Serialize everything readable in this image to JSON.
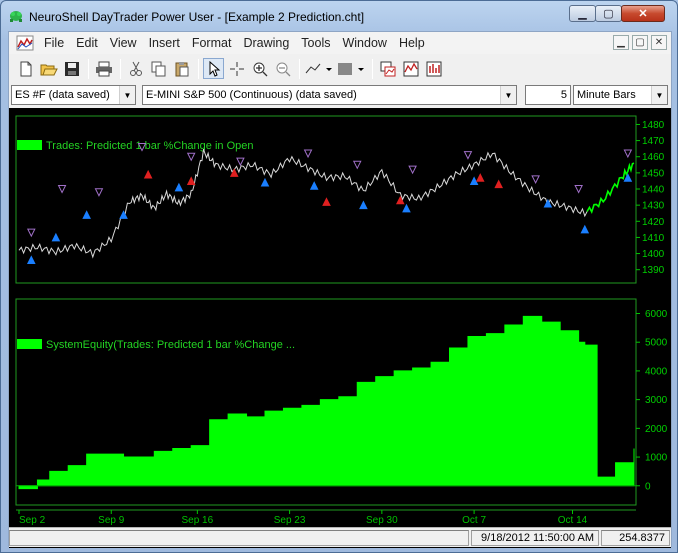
{
  "window": {
    "title": "NeuroShell DayTrader Power User - [Example 2 Prediction.cht]",
    "controls": {
      "minimize": "▁",
      "maximize": "▢",
      "close": "✕"
    }
  },
  "menu": {
    "items": [
      "File",
      "Edit",
      "View",
      "Insert",
      "Format",
      "Drawing",
      "Tools",
      "Window",
      "Help"
    ],
    "mdi": {
      "minimize": "▁",
      "restore": "▢",
      "close": "✕"
    }
  },
  "toolbar": {
    "icons": [
      "new-file-icon",
      "open-folder-icon",
      "save-icon",
      "print-icon",
      "cut-icon",
      "copy-icon",
      "paste-icon",
      "pointer-icon",
      "crosshair-icon",
      "zoom-in-icon",
      "zoom-out-icon",
      "line-draw-icon",
      "fill-pattern-icon",
      "chart-window-icon",
      "chart-style-icon",
      "chart-bars-icon"
    ]
  },
  "selectors": {
    "symbol": "ES #F (data saved)",
    "instrument": "E-MINI S&P 500 (Continuous) (data saved)",
    "bar_count": "5",
    "bar_type": "Minute Bars"
  },
  "status": {
    "datetime": "9/18/2012 11:50:00 AM",
    "value": "254.8377"
  },
  "colors": {
    "price_line": "#d9d9d9",
    "green": "#00ff00",
    "buy_marker": "#1a7fff",
    "sell_marker": "#a070c8",
    "short_marker": "#e02020",
    "axis": "#00c800"
  },
  "chart_data": [
    {
      "type": "line",
      "title": "Trades: Predicted 1 bar %Change in Open",
      "ylim": [
        1383,
        1484
      ],
      "y_ticks": [
        1390,
        1400,
        1410,
        1420,
        1430,
        1440,
        1450,
        1460,
        1470,
        1480
      ],
      "x_ticks": [
        "Sep 2",
        "Sep 9",
        "Sep 16",
        "Sep 23",
        "Sep 30",
        "Oct 7",
        "Oct 14"
      ],
      "x": [
        0,
        3,
        6,
        9,
        12,
        15,
        18,
        20,
        22,
        24,
        26,
        28,
        30,
        32,
        35,
        38,
        41,
        44,
        47,
        50,
        53,
        56,
        59,
        62,
        65,
        68,
        71,
        74,
        77,
        80,
        83,
        86,
        89,
        92,
        95,
        98,
        100
      ],
      "series": [
        {
          "values": [
            1402,
            1404,
            1401,
            1405,
            1400,
            1409,
            1432,
            1436,
            1428,
            1437,
            1431,
            1437,
            1463,
            1455,
            1452,
            1455,
            1449,
            1459,
            1453,
            1447,
            1448,
            1439,
            1451,
            1436,
            1434,
            1441,
            1449,
            1455,
            1462,
            1450,
            1440,
            1432,
            1429,
            1425,
            1433,
            1447,
            1456
          ]
        }
      ],
      "markers": {
        "buy": [
          [
            2,
            1396
          ],
          [
            6,
            1410
          ],
          [
            11,
            1424
          ],
          [
            17,
            1424
          ],
          [
            26,
            1441
          ],
          [
            40,
            1444
          ],
          [
            48,
            1442
          ],
          [
            56,
            1430
          ],
          [
            63,
            1428
          ],
          [
            74,
            1445
          ],
          [
            86,
            1431
          ],
          [
            92,
            1415
          ],
          [
            99,
            1447
          ]
        ],
        "sell": [
          [
            2,
            1413
          ],
          [
            7,
            1440
          ],
          [
            13,
            1438
          ],
          [
            20,
            1466
          ],
          [
            28,
            1460
          ],
          [
            36,
            1457
          ],
          [
            47,
            1462
          ],
          [
            55,
            1455
          ],
          [
            64,
            1452
          ],
          [
            73,
            1461
          ],
          [
            84,
            1446
          ],
          [
            91,
            1440
          ],
          [
            99,
            1462
          ]
        ],
        "short": [
          [
            21,
            1449
          ],
          [
            28,
            1445
          ],
          [
            35,
            1450
          ],
          [
            50,
            1432
          ],
          [
            62,
            1433
          ],
          [
            75,
            1447
          ],
          [
            78,
            1443
          ]
        ]
      }
    },
    {
      "type": "area",
      "title": "SystemEquity(Trades: Predicted 1 bar %Change ...",
      "ylim": [
        -600,
        6400
      ],
      "y_ticks": [
        0,
        1000,
        2000,
        3000,
        4000,
        5000,
        6000
      ],
      "x": [
        0,
        3,
        5,
        8,
        11,
        14,
        17,
        19,
        22,
        25,
        28,
        31,
        34,
        37,
        40,
        43,
        46,
        49,
        52,
        55,
        58,
        61,
        64,
        67,
        70,
        73,
        76,
        79,
        82,
        85,
        88,
        91,
        92,
        94,
        97,
        100
      ],
      "series": [
        {
          "values": [
            -100,
            200,
            500,
            700,
            1100,
            1100,
            1000,
            1000,
            1200,
            1300,
            1400,
            2300,
            2500,
            2400,
            2600,
            2700,
            2800,
            3000,
            3100,
            3600,
            3800,
            4000,
            4100,
            4300,
            4800,
            5200,
            5300,
            5600,
            5900,
            5700,
            5400,
            5000,
            4900,
            300,
            800,
            1300
          ]
        }
      ]
    }
  ]
}
